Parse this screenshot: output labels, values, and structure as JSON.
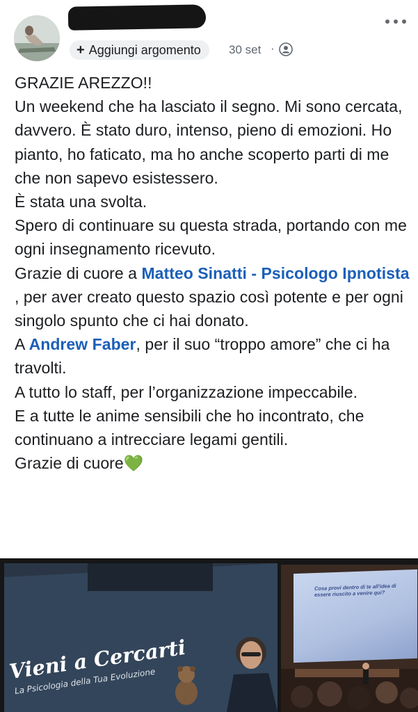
{
  "post": {
    "add_topic_label": "Aggiungi argomento",
    "date": "30 set",
    "separator": "·",
    "paragraphs": {
      "p1": "GRAZIE AREZZO!!",
      "p2": "Un weekend che ha lasciato il segno. Mi sono cercata, davvero. È stato duro, intenso, pieno di emozioni. Ho pianto, ho faticato, ma ho anche scoperto parti di me che non sapevo esistessero.",
      "p3": "È stata una svolta.",
      "p4": "Spero di continuare su questa strada, portando con me ogni insegnamento ricevuto.",
      "p5_before": "Grazie di cuore a ",
      "p5_mention": "Matteo Sinatti - Psicologo Ipnotista",
      "p5_after": " , per aver creato questo spazio così potente e per ogni singolo spunto che ci hai donato.",
      "p6_before": "A ",
      "p6_mention": "Andrew Faber",
      "p6_after": ", per il suo “troppo amore” che ci ha travolti.",
      "p7": "A tutto lo staff, per l’organizzazione impeccabile.",
      "p8": "E a tutte le anime sensibili che ho incontrato, che continuano a intrecciare legami gentili.",
      "p9": "Grazie di  cuore💚"
    }
  },
  "photos": {
    "slide_title": "Vieni a Cercarti",
    "slide_subtitle": "La Psicologia della Tua Evoluzione",
    "screen_question": "Cosa provi dentro di te all'idea di essere riuscito a venire qui?"
  },
  "colors": {
    "mention": "#1b5fb8",
    "meta_gray": "#606770",
    "pill_bg": "#eef0f2"
  },
  "icons": {
    "privacy": "friends-icon",
    "more": "more-dots-icon"
  }
}
